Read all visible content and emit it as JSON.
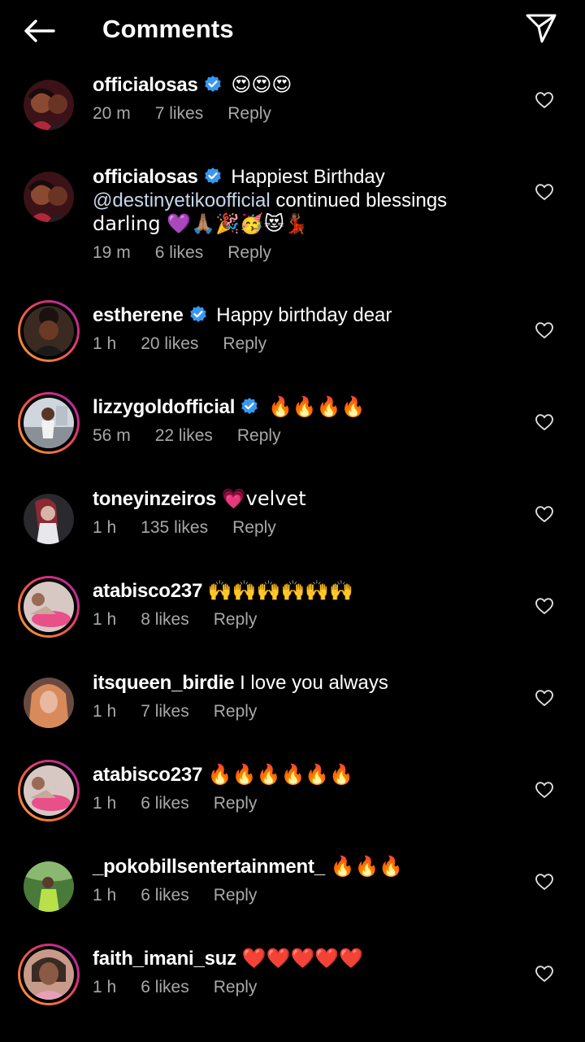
{
  "header": {
    "title": "Comments",
    "back_icon": "arrow-left-icon",
    "share_icon": "paper-plane-icon"
  },
  "colors": {
    "background": "#000000",
    "text": "#ffffff",
    "meta_text": "#a8a8a8",
    "verified_blue": "#3897f0",
    "story_ring_start": "#f9a13a",
    "story_ring_end": "#9c2bbd"
  },
  "comments": [
    {
      "username": "officialosas",
      "verified": true,
      "text": "😍😍😍",
      "time": "20 m",
      "likes": "7 likes",
      "reply": "Reply",
      "ring": false
    },
    {
      "username": "officialosas",
      "verified": true,
      "text_line1": "Happiest Birthday",
      "text_line2_mention": "@destinyetikoofficial",
      "text_line2_rest": " continued blessings",
      "text_line3": "darling 💜🙏🏽🎉🥳😻💃🏾",
      "time": "19 m",
      "likes": "6 likes",
      "reply": "Reply",
      "ring": false
    },
    {
      "username": "estherene",
      "verified": true,
      "text": "Happy birthday dear",
      "time": "1 h",
      "likes": "20 likes",
      "reply": "Reply",
      "ring": true
    },
    {
      "username": "lizzygoldofficial",
      "verified": true,
      "text": "🔥🔥🔥🔥",
      "time": "56 m",
      "likes": "22 likes",
      "reply": "Reply",
      "ring": true
    },
    {
      "username": "toneyinzeiros",
      "verified": false,
      "text": "💗velvet",
      "time": "1 h",
      "likes": "135 likes",
      "reply": "Reply",
      "ring": false
    },
    {
      "username": "atabisco237",
      "verified": false,
      "text": "🙌🙌🙌🙌🙌🙌",
      "time": "1 h",
      "likes": "8 likes",
      "reply": "Reply",
      "ring": true
    },
    {
      "username": "itsqueen_birdie",
      "verified": false,
      "text": "I love you always",
      "time": "1 h",
      "likes": "7 likes",
      "reply": "Reply",
      "ring": false
    },
    {
      "username": "atabisco237",
      "verified": false,
      "text": "🔥🔥🔥🔥🔥🔥",
      "time": "1 h",
      "likes": "6 likes",
      "reply": "Reply",
      "ring": true
    },
    {
      "username": "_pokobillsentertainment_",
      "verified": false,
      "text": "🔥🔥🔥",
      "time": "1 h",
      "likes": "6 likes",
      "reply": "Reply",
      "ring": false
    },
    {
      "username": "faith_imani_suz",
      "verified": false,
      "text": "❤️❤️❤️❤️❤️",
      "time": "1 h",
      "likes": "6 likes",
      "reply": "Reply",
      "ring": true
    }
  ]
}
